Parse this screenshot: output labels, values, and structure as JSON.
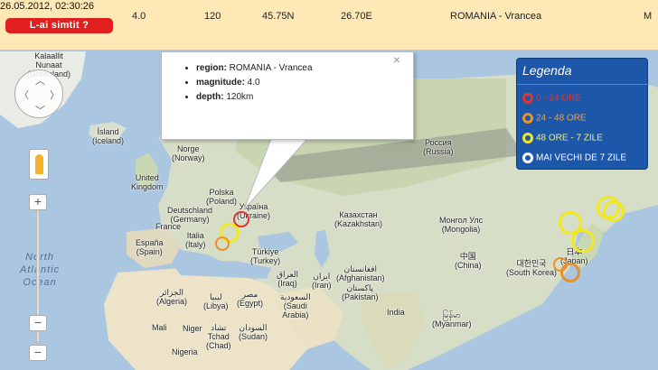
{
  "record": {
    "datetime": "26.05.2012, 02:30:26",
    "felt_button": "L-ai simtit ?",
    "magnitude": "4.0",
    "depth": "120",
    "lat": "45.75N",
    "lon": "26.70E",
    "region": "ROMANIA - Vrancea",
    "map_link": "M"
  },
  "popup": {
    "region_label": "region:",
    "region_value": "ROMANIA - Vrancea",
    "magnitude_label": "magnitude:",
    "magnitude_value": "4.0",
    "depth_label": "depth:",
    "depth_value": "120km",
    "close": "×"
  },
  "legend": {
    "title": "Legenda",
    "items": [
      {
        "label": "0 - 24 ORE",
        "color": "#e3342f"
      },
      {
        "label": "24 - 48 ORE",
        "color": "#e8902a"
      },
      {
        "label": "48 ORE - 7 ZILE",
        "color": "#f2e81f"
      },
      {
        "label": "MAI VECHI DE 7 ZILE",
        "color": "#ffffff"
      }
    ]
  },
  "controls": {
    "zoom_in": "+",
    "zoom_out": "−",
    "zoom_min": "−",
    "pan_icons": [
      "chevron-up-icon",
      "chevron-left-icon",
      "chevron-right-icon",
      "chevron-down-icon"
    ]
  },
  "places": {
    "greenland": "Kalaallit\nNunaat\n(Greenland)",
    "iceland": "Ísland\n(Iceland)",
    "norway": "Norge\n(Norway)",
    "uk": "United\nKingdom",
    "poland": "Polska\n(Poland)",
    "germany": "Deutschland\n(Germany)",
    "ukraine": "Україна\n(Ukraine)",
    "france": "France",
    "italy": "Italia\n(Italy)",
    "spain": "España\n(Spain)",
    "turkey": "Türkiye\n(Turkey)",
    "russia": "Россия\n(Russia)",
    "kazakhstan": "Казахстан\n(Kazakhstan)",
    "mongolia": "Монгол Улс\n(Mongolia)",
    "china": "中国\n(China)",
    "japan": "日本\n(Japan)",
    "korea": "대한민국\n(South Korea)",
    "algeria": "الجزائر\n(Algeria)",
    "libya": "ليبيا\n(Libya)",
    "egypt": "مصر\n(Egypt)",
    "iraq": "العراق\n(Iraq)",
    "iran": "ایران\n(Iran)",
    "afghanistan": "افغانستان\n(Afghanistan)",
    "pakistan": "پاکستان\n(Pakistan)",
    "saudi": "السعودية\n(Saudi\nArabia)",
    "india": "India",
    "mali": "Mali",
    "niger": "Niger",
    "chad": "تشاد\nTchad\n(Chad)",
    "sudan": "السودان\n(Sudan)",
    "nigeria": "Nigeria",
    "myanmar": "မြန်မာ\n(Myanmar)",
    "north_atlantic": "North\nAtlantic\nOcean"
  }
}
